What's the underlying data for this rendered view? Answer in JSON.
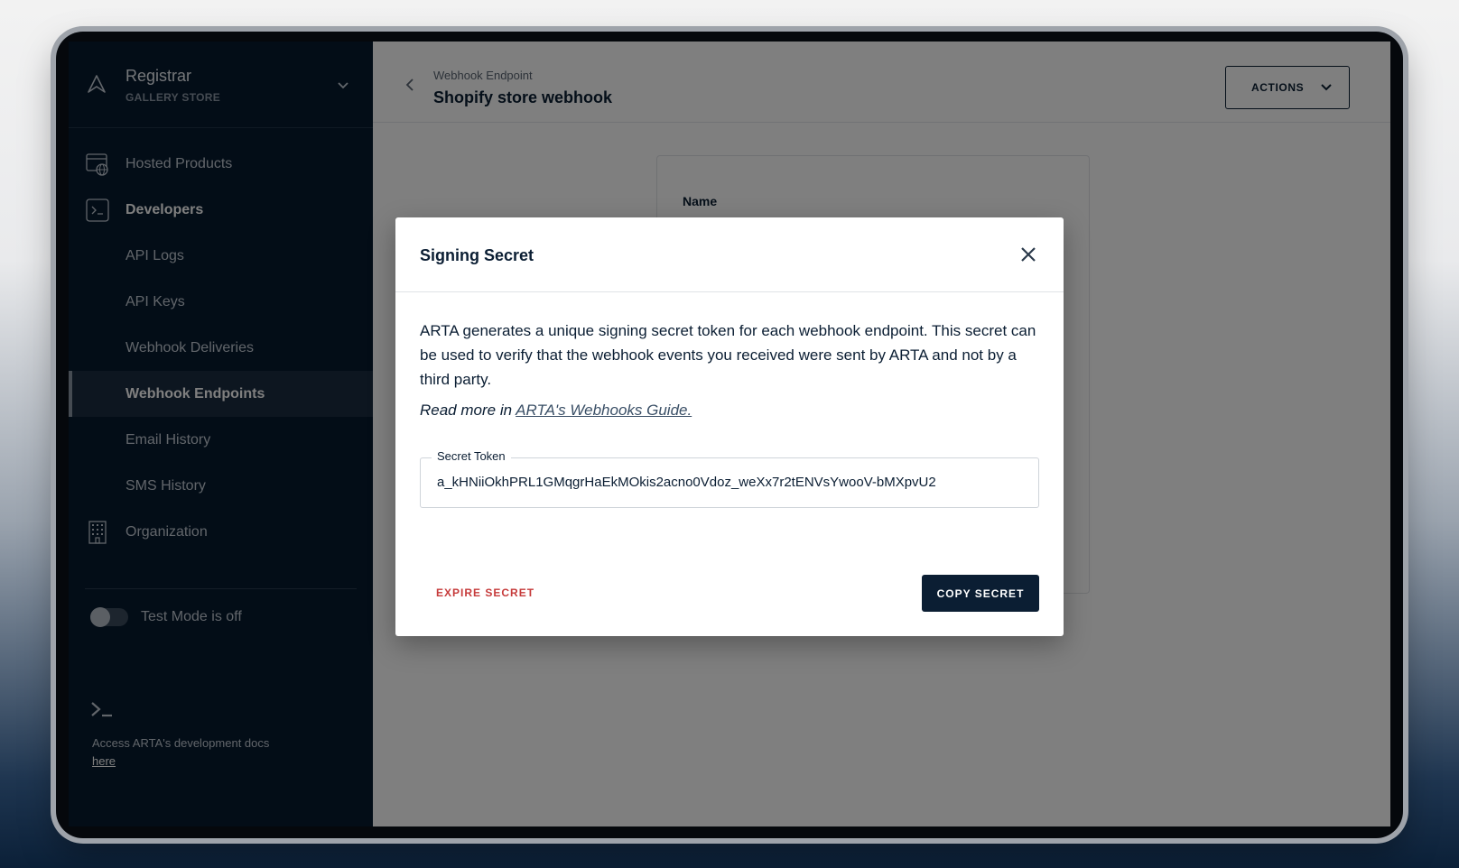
{
  "org": {
    "name": "Registrar",
    "subtitle": "GALLERY STORE"
  },
  "sidebar": {
    "items": [
      {
        "label": "Hosted Products",
        "icon": "globe-browser-icon"
      },
      {
        "label": "Developers",
        "icon": "terminal-icon"
      },
      {
        "label": "API Logs"
      },
      {
        "label": "API Keys"
      },
      {
        "label": "Webhook Deliveries"
      },
      {
        "label": "Webhook Endpoints"
      },
      {
        "label": "Email History"
      },
      {
        "label": "SMS History"
      },
      {
        "label": "Organization",
        "icon": "building-icon"
      }
    ],
    "test_mode_label": "Test Mode is off",
    "docs_text": "Access ARTA's development docs ",
    "docs_link": "here"
  },
  "header": {
    "breadcrumb": "Webhook Endpoint",
    "title": "Shopify store webhook",
    "actions_label": "ACTIONS"
  },
  "card": {
    "name_label": "Name"
  },
  "modal": {
    "title": "Signing Secret",
    "description": "ARTA generates a unique signing secret token for each webhook endpoint. This secret can be used to verify that the webhook events you received were sent by ARTA and not by a third party.",
    "read_more_prefix": "Read more in ",
    "read_more_link": "ARTA's Webhooks Guide.",
    "field_label": "Secret Token",
    "field_value": "a_kHNiiOkhPRL1GMqgrHaEkMOkis2acno0Vdoz_weXx7r2tENVsYwooV-bMXpvU2",
    "expire_label": "EXPIRE SECRET",
    "copy_label": "COPY SECRET"
  },
  "colors": {
    "sidebar_bg": "#071a2e",
    "accent_dark": "#0b1e33",
    "danger": "#c63b3b"
  }
}
